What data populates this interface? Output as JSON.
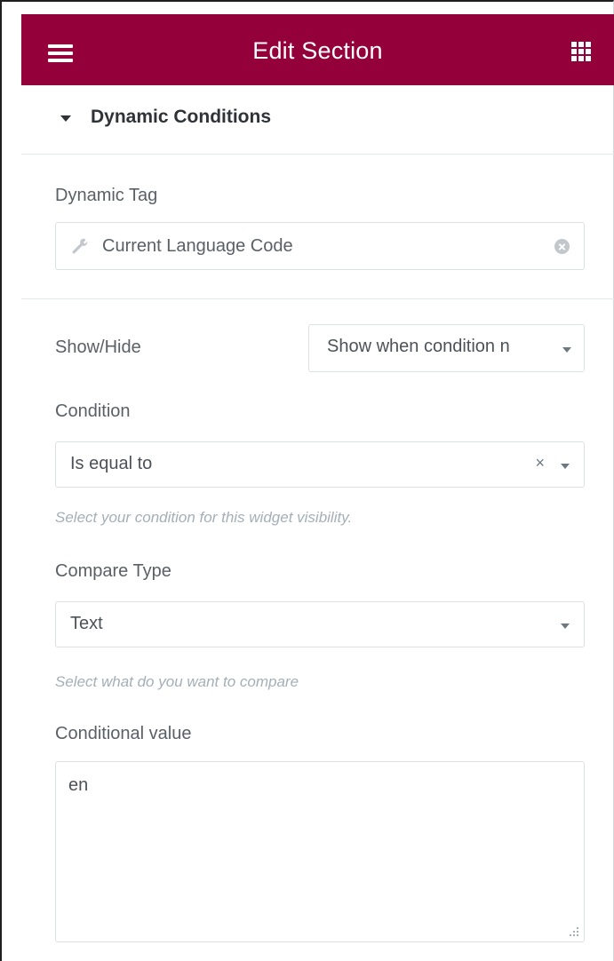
{
  "header": {
    "title": "Edit Section",
    "menu_icon": "hamburger-menu-icon",
    "widgets_icon": "grid-apps-icon",
    "background_color": "#93003a"
  },
  "section": {
    "title": "Dynamic Conditions",
    "expanded": true
  },
  "dynamic_tag": {
    "label": "Dynamic Tag",
    "value": "Current Language Code",
    "icon": "wrench-icon"
  },
  "show_hide": {
    "label": "Show/Hide",
    "value": "Show when condition n"
  },
  "condition": {
    "label": "Condition",
    "value": "Is equal to",
    "clear_symbol": "×",
    "description": "Select your condition for this widget visibility."
  },
  "compare_type": {
    "label": "Compare Type",
    "value": "Text",
    "description": "Select what do you want to compare"
  },
  "conditional_value": {
    "label": "Conditional value",
    "value": "en"
  }
}
